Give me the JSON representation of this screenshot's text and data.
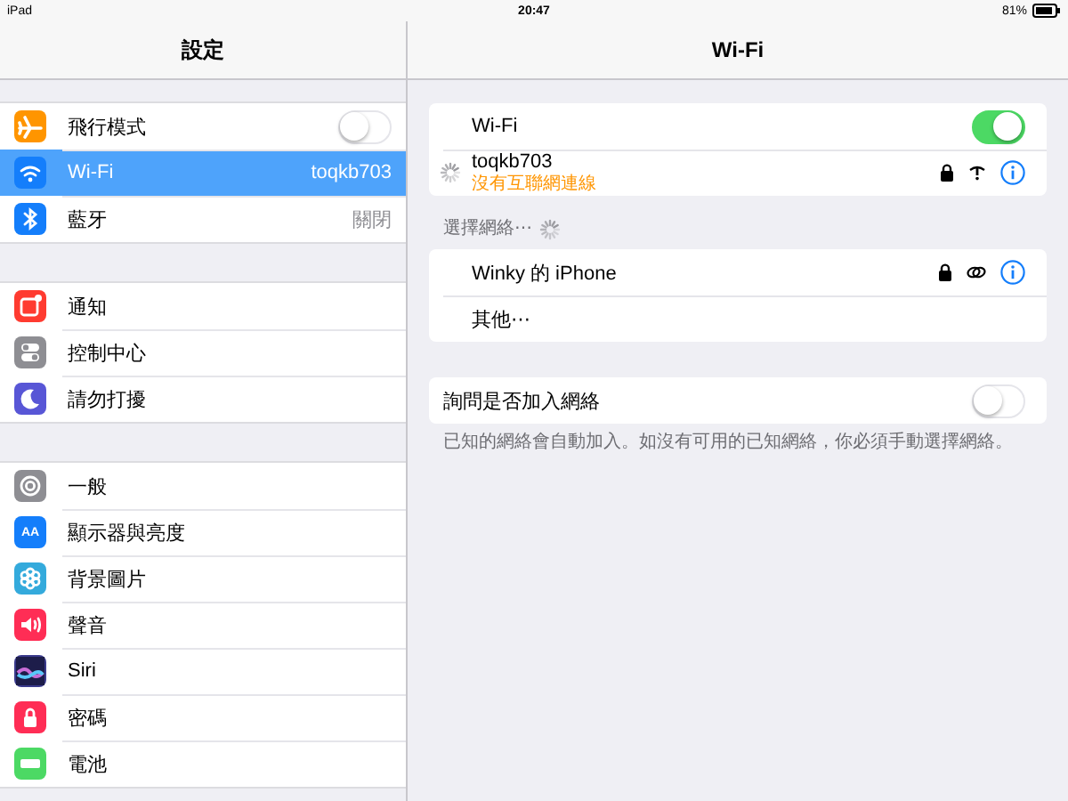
{
  "status_bar": {
    "device": "iPad",
    "time": "20:47",
    "battery": "81%"
  },
  "sidebar": {
    "title": "設定",
    "groups": [
      [
        {
          "label": "飛行模式",
          "kind": "toggle",
          "on": false,
          "selected": false,
          "color": "#ff9500"
        },
        {
          "label": "Wi-Fi",
          "kind": "value",
          "value": "toqkb703",
          "selected": true,
          "color": "#147efb"
        },
        {
          "label": "藍牙",
          "kind": "value",
          "value": "關閉",
          "selected": false,
          "color": "#147efb"
        }
      ],
      [
        {
          "label": "通知",
          "kind": "plain",
          "selected": false,
          "color": "#ff3b30"
        },
        {
          "label": "控制中心",
          "kind": "plain",
          "selected": false,
          "color": "#8e8e93"
        },
        {
          "label": "請勿打擾",
          "kind": "plain",
          "selected": false,
          "color": "#5856d6"
        }
      ],
      [
        {
          "label": "一般",
          "kind": "plain",
          "selected": false,
          "color": "#8e8e93"
        },
        {
          "label": "顯示器與亮度",
          "kind": "plain",
          "selected": false,
          "color": "#147efb",
          "icon_text": "AA"
        },
        {
          "label": "背景圖片",
          "kind": "plain",
          "selected": false,
          "color": "#34aadc"
        },
        {
          "label": "聲音",
          "kind": "plain",
          "selected": false,
          "color": "#ff2d55"
        },
        {
          "label": "Siri",
          "kind": "plain",
          "selected": false,
          "color": "#3a3a8c"
        },
        {
          "label": "密碼",
          "kind": "plain",
          "selected": false,
          "color": "#ff2d55"
        },
        {
          "label": "電池",
          "kind": "plain",
          "selected": false,
          "color": "#4cd964"
        }
      ]
    ]
  },
  "detail": {
    "title": "Wi-Fi",
    "wifi": {
      "label": "Wi-Fi",
      "on": true
    },
    "current_network": {
      "name": "toqkb703",
      "status": "沒有互聯網連線"
    },
    "section_label": "選擇網絡⋯",
    "networks": [
      {
        "name": "Winky 的 iPhone",
        "kind": "network"
      },
      {
        "name": "其他⋯",
        "kind": "other"
      }
    ],
    "ask_to_join": {
      "label": "詢問是否加入網絡",
      "on": false
    },
    "footnote": "已知的網絡會自動加入。如沒有可用的已知網絡，你必須手動選擇網絡。"
  }
}
